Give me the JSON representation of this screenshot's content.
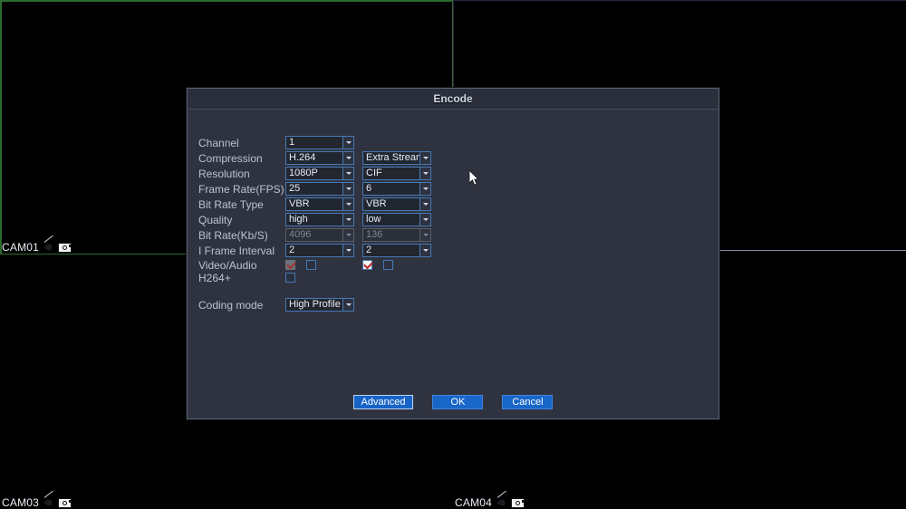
{
  "video_wall": {
    "cameras": [
      {
        "id": "cam01",
        "label": "CAM01",
        "icons": [
          "speaker-mute-icon",
          "record-camera-icon"
        ]
      },
      {
        "id": "cam03",
        "label": "CAM03",
        "icons": [
          "speaker-mute-icon",
          "record-camera-icon"
        ]
      },
      {
        "id": "cam04",
        "label": "CAM04",
        "icons": [
          "speaker-mute-icon",
          "record-camera-icon"
        ]
      }
    ],
    "selected_border_color": "#2d6b2d",
    "divider_color": "#8d87a8",
    "background_color": "#000000"
  },
  "dialog": {
    "title": "Encode",
    "background_color": "#2f3340",
    "border_color": "#575d6d",
    "accent_color": "#4679b4",
    "rows": {
      "channel": {
        "label": "Channel",
        "main": "1"
      },
      "compression": {
        "label": "Compression",
        "main": "H.264",
        "sub": "Extra Stream"
      },
      "resolution": {
        "label": "Resolution",
        "main": "1080P",
        "sub": "CIF"
      },
      "frame_rate": {
        "label": "Frame Rate(FPS)",
        "main": "25",
        "sub": "6"
      },
      "bit_rate_type": {
        "label": "Bit Rate Type",
        "main": "VBR",
        "sub": "VBR"
      },
      "quality": {
        "label": "Quality",
        "main": "high",
        "sub": "low"
      },
      "bit_rate": {
        "label": "Bit Rate(Kb/S)",
        "main": "4096",
        "sub": "136",
        "disabled": true
      },
      "i_frame_interval": {
        "label": "I Frame Interval",
        "main": "2",
        "sub": "2"
      },
      "video_audio": {
        "label": "Video/Audio",
        "main_video_checked": true,
        "main_video_disabled": true,
        "main_audio_checked": false,
        "sub_video_checked": true,
        "sub_audio_checked": false
      },
      "h264plus": {
        "label": "H264+",
        "checked": false
      },
      "coding_mode": {
        "label": "Coding mode",
        "main": "High Profile"
      }
    },
    "buttons": {
      "advanced": "Advanced",
      "ok": "OK",
      "cancel": "Cancel"
    }
  }
}
